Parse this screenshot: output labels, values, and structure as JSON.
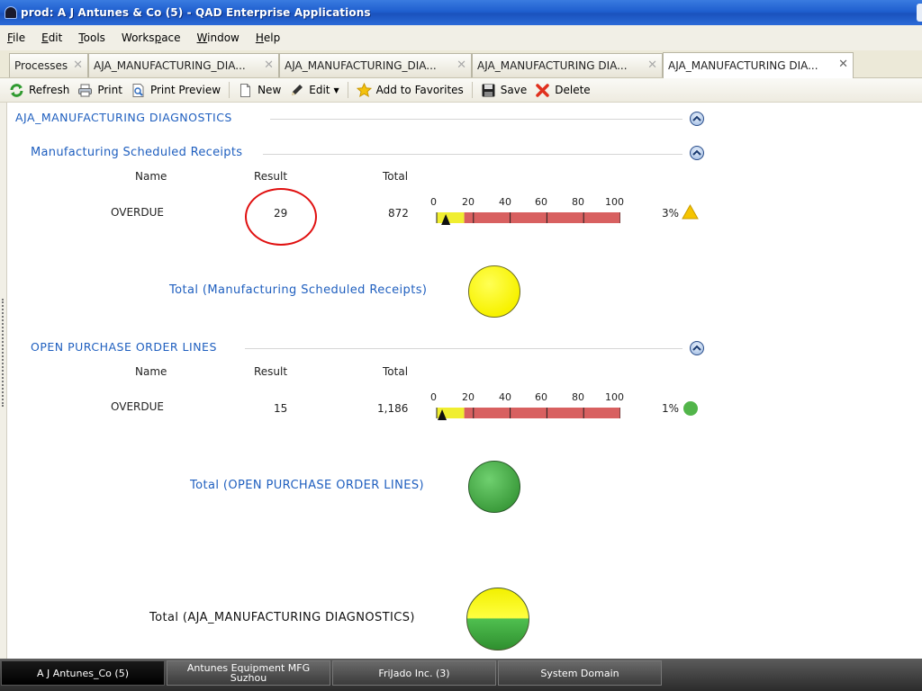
{
  "window": {
    "title": "prod: A J Antunes & Co (5) - QAD Enterprise Applications"
  },
  "menu": [
    {
      "first": "F",
      "rest": "ile"
    },
    {
      "first": "E",
      "rest": "dit"
    },
    {
      "first": "T",
      "rest": "ools"
    },
    {
      "first": "Works",
      "u": "p",
      "rest": "ace"
    },
    {
      "first": "W",
      "rest": "indow"
    },
    {
      "first": "H",
      "rest": "elp"
    }
  ],
  "tabs": [
    {
      "label": "Processes"
    },
    {
      "label": "AJA_MANUFACTURING_DIA..."
    },
    {
      "label": "AJA_MANUFACTURING_DIA..."
    },
    {
      "label": "AJA_MANUFACTURING DIA..."
    },
    {
      "label": "AJA_MANUFACTURING DIA..."
    }
  ],
  "toolbar": {
    "refresh": "Refresh",
    "print": "Print",
    "print_preview": "Print Preview",
    "new": "New",
    "edit": "Edit",
    "add_favorites": "Add to Favorites",
    "save": "Save",
    "delete": "Delete"
  },
  "dashboard": {
    "title": "AJA_MANUFACTURING DIAGNOSTICS",
    "headers": {
      "name": "Name",
      "result": "Result",
      "total": "Total"
    },
    "gauge_ticks": [
      "0",
      "20",
      "40",
      "60",
      "80",
      "100"
    ],
    "sections": [
      {
        "title": "Manufacturing Scheduled Receipts",
        "row": {
          "name": "OVERDUE",
          "result": "29",
          "total": "872",
          "percent": "3%",
          "percent_value": 3,
          "status": "warning"
        },
        "total_label": "Total (Manufacturing Scheduled Receipts)",
        "total_status_color": "#ffff00"
      },
      {
        "title": "OPEN PURCHASE ORDER LINES",
        "row": {
          "name": "OVERDUE",
          "result": "15",
          "total": "1,186",
          "percent": "1%",
          "percent_value": 1,
          "status": "ok"
        },
        "total_label": "Total (OPEN PURCHASE ORDER LINES)",
        "total_status_color": "#3fae3f"
      }
    ],
    "grand_total_label": "Total (AJA_MANUFACTURING DIAGNOSTICS)"
  },
  "colors": {
    "gauge_yellow": "#f0ee30",
    "gauge_red": "#d86060",
    "warning": "#f5c400",
    "ok": "#52b54a",
    "link_blue": "#1f5fbf"
  },
  "taskbar": [
    {
      "label": "A J Antunes_Co (5)",
      "active": true
    },
    {
      "label": "Antunes Equipment MFG\nSuzhou",
      "active": false
    },
    {
      "label": "FriJado Inc. (3)",
      "active": false
    },
    {
      "label": "System Domain",
      "active": false
    }
  ]
}
